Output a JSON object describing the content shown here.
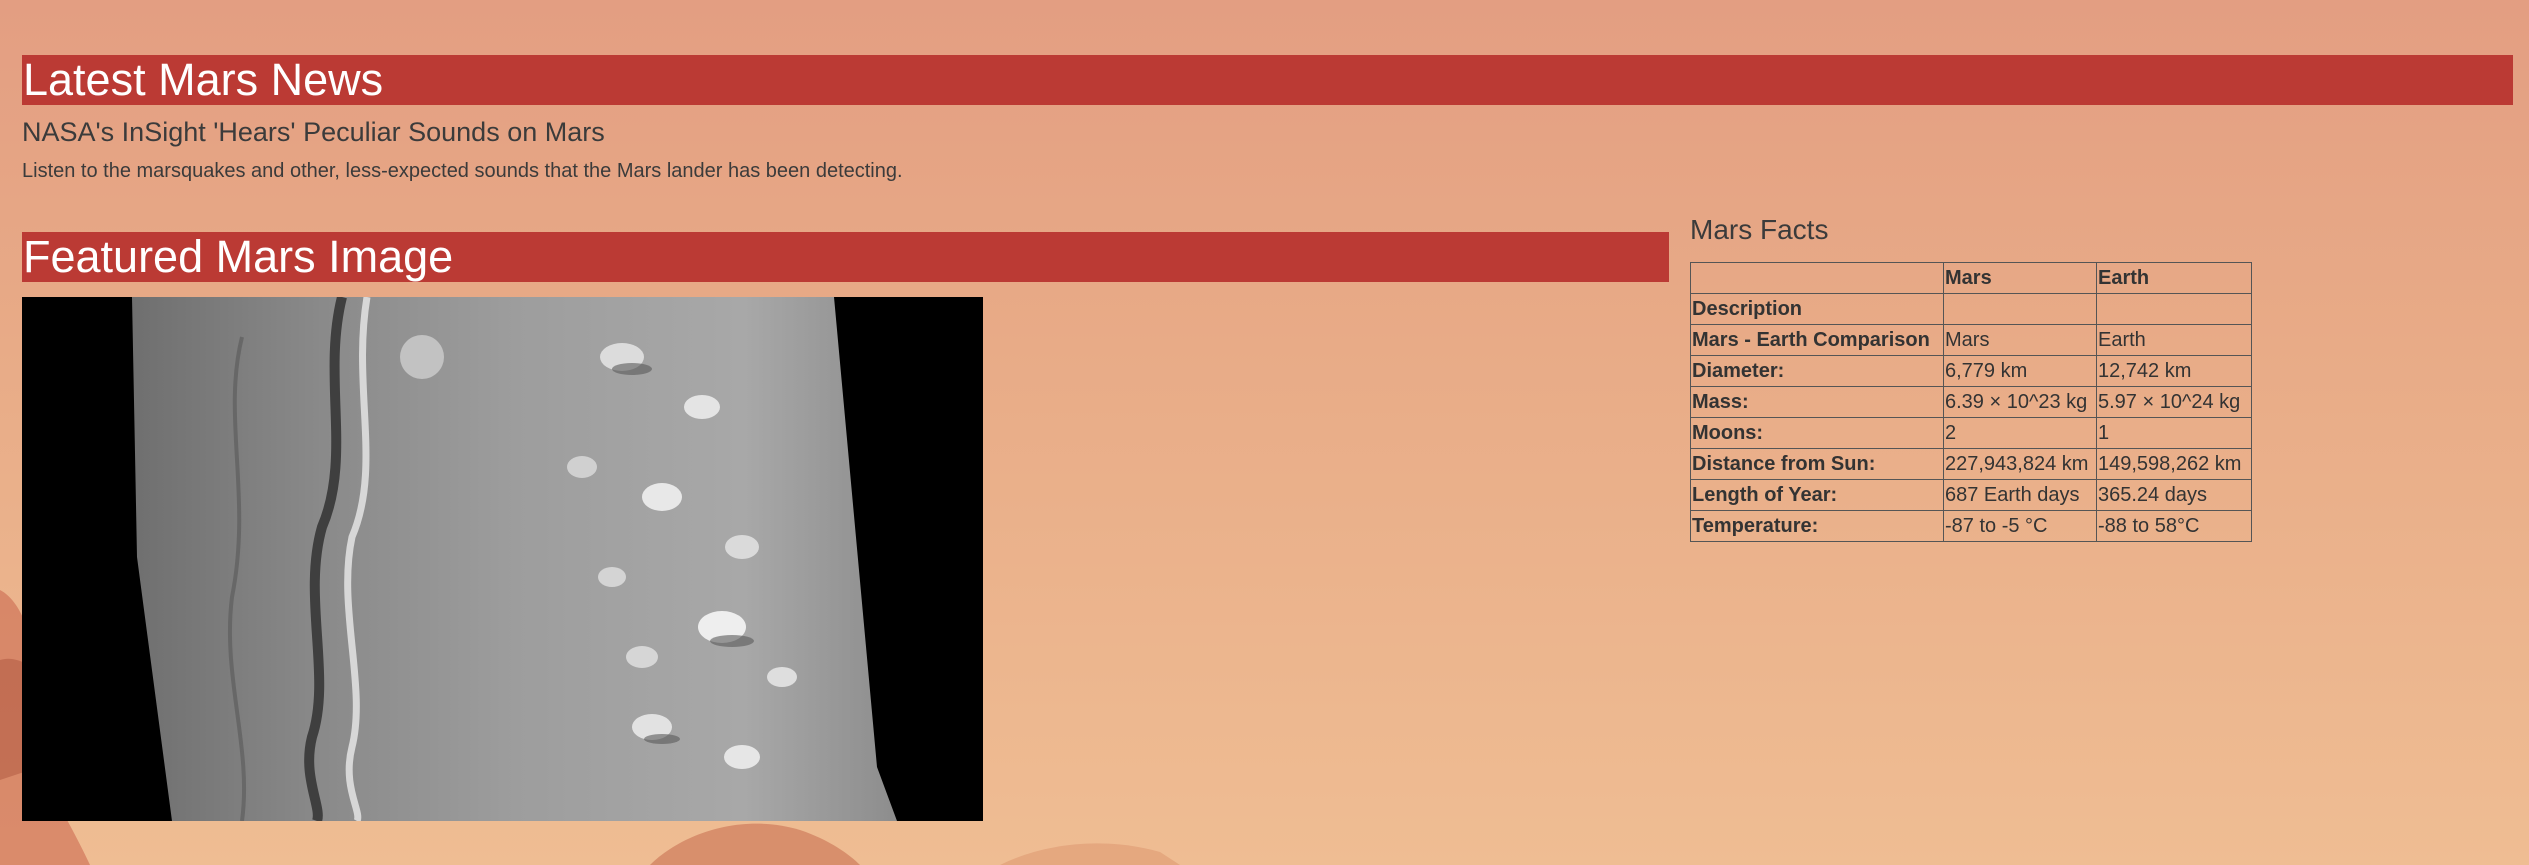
{
  "news": {
    "heading": "Latest Mars News",
    "title": "NASA's InSight 'Hears' Peculiar Sounds on Mars",
    "teaser": "Listen to the marsquakes and other, less-expected sounds that the Mars lander has been detecting."
  },
  "featured": {
    "heading": "Featured Mars Image"
  },
  "facts": {
    "heading": "Mars Facts",
    "columns": [
      "",
      "Mars",
      "Earth"
    ],
    "rows": [
      {
        "label": "Description",
        "mars": "",
        "earth": ""
      },
      {
        "label": "Mars - Earth Comparison",
        "mars": "Mars",
        "earth": "Earth"
      },
      {
        "label": "Diameter:",
        "mars": "6,779 km",
        "earth": "12,742 km"
      },
      {
        "label": "Mass:",
        "mars": "6.39 × 10^23 kg",
        "earth": "5.97 × 10^24 kg"
      },
      {
        "label": "Moons:",
        "mars": "2",
        "earth": "1"
      },
      {
        "label": "Distance from Sun:",
        "mars": "227,943,824 km",
        "earth": "149,598,262 km"
      },
      {
        "label": "Length of Year:",
        "mars": "687 Earth days",
        "earth": "365.24 days"
      },
      {
        "label": "Temperature:",
        "mars": "-87 to -5 °C",
        "earth": "-88 to 58°C"
      }
    ]
  },
  "colors": {
    "banner": "#bb3a34",
    "background": "#e8ab87",
    "text": "#333333"
  }
}
